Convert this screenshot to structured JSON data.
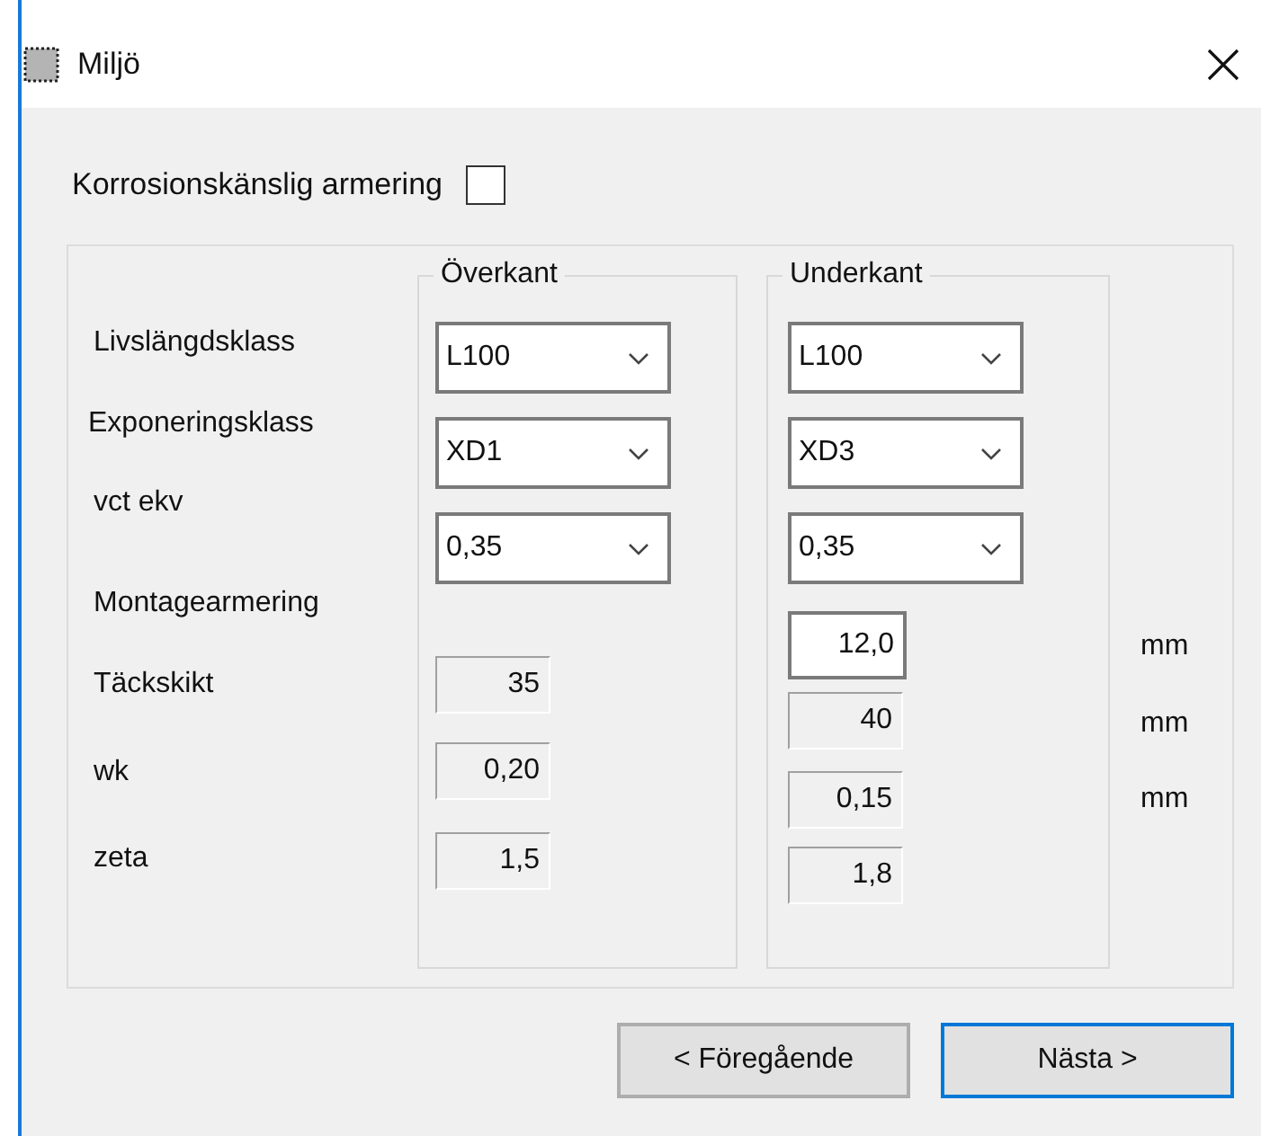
{
  "window": {
    "title": "Miljö"
  },
  "corrosion_option": {
    "label": "Korrosionskänslig armering",
    "checked": false
  },
  "row_labels": [
    "Livslängdsklass",
    "Exponeringsklass",
    "vct ekv",
    "Montagearmering",
    "Täckskikt",
    "wk",
    "zeta"
  ],
  "groups": [
    {
      "title": "Överkant",
      "dropdowns": [
        "L100",
        "XD1",
        "0,35"
      ],
      "fields": [
        {
          "value": "35",
          "kind": "readonly"
        },
        {
          "value": "0,20",
          "kind": "readonly"
        },
        {
          "value": "1,5",
          "kind": "readonly"
        }
      ]
    },
    {
      "title": "Underkant",
      "dropdowns": [
        "L100",
        "XD3",
        "0,35"
      ],
      "fields": [
        {
          "value": "12,0",
          "kind": "editable"
        },
        {
          "value": "40",
          "kind": "readonly"
        },
        {
          "value": "0,15",
          "kind": "readonly"
        },
        {
          "value": "1,8",
          "kind": "readonly"
        }
      ]
    }
  ],
  "units": [
    "mm",
    "mm",
    "mm"
  ],
  "buttons": [
    {
      "label": "< Föregående",
      "focused": false
    },
    {
      "label": "Nästa >",
      "focused": true
    }
  ]
}
